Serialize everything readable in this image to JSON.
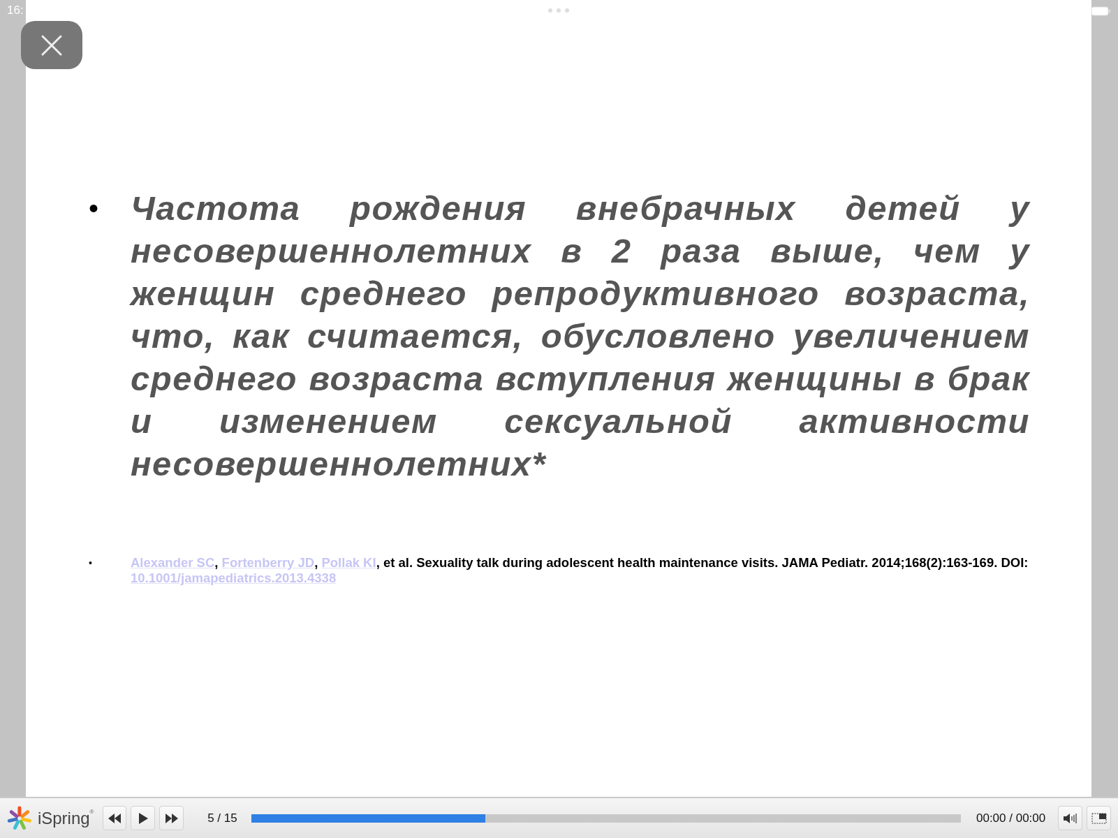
{
  "status_bar": {
    "time": "16:"
  },
  "slide": {
    "bullet": "•",
    "main_text": "Частота рождения внебрачных детей у несовершеннолетних в 2 раза выше, чем у женщин среднего репродуктивного возраста, что, как считается, обусловлено увеличением среднего возраста вступления женщины в брак и изменением сексуальной активности несовершеннолетних*",
    "citation": {
      "bullet": "•",
      "parts": [
        {
          "kind": "link",
          "text": "Alexander SC"
        },
        {
          "kind": "text",
          "text": ", "
        },
        {
          "kind": "link",
          "text": "Fortenberry JD"
        },
        {
          "kind": "text",
          "text": ", "
        },
        {
          "kind": "link",
          "text": "Pollak KI"
        },
        {
          "kind": "text",
          "text": ", et al. Sexuality talk during adolescent health maintenance visits. JAMA Pediatr. 2014;168(2):163-169. DOI: "
        },
        {
          "kind": "link",
          "text": "10.1001/jamapediatrics.2013.4338"
        }
      ]
    }
  },
  "player": {
    "brand": "iSpring",
    "brand_mark": "®",
    "slide_counter": "5 / 15",
    "progress": {
      "level": 0.33
    },
    "time": "00:00 / 00:00"
  }
}
